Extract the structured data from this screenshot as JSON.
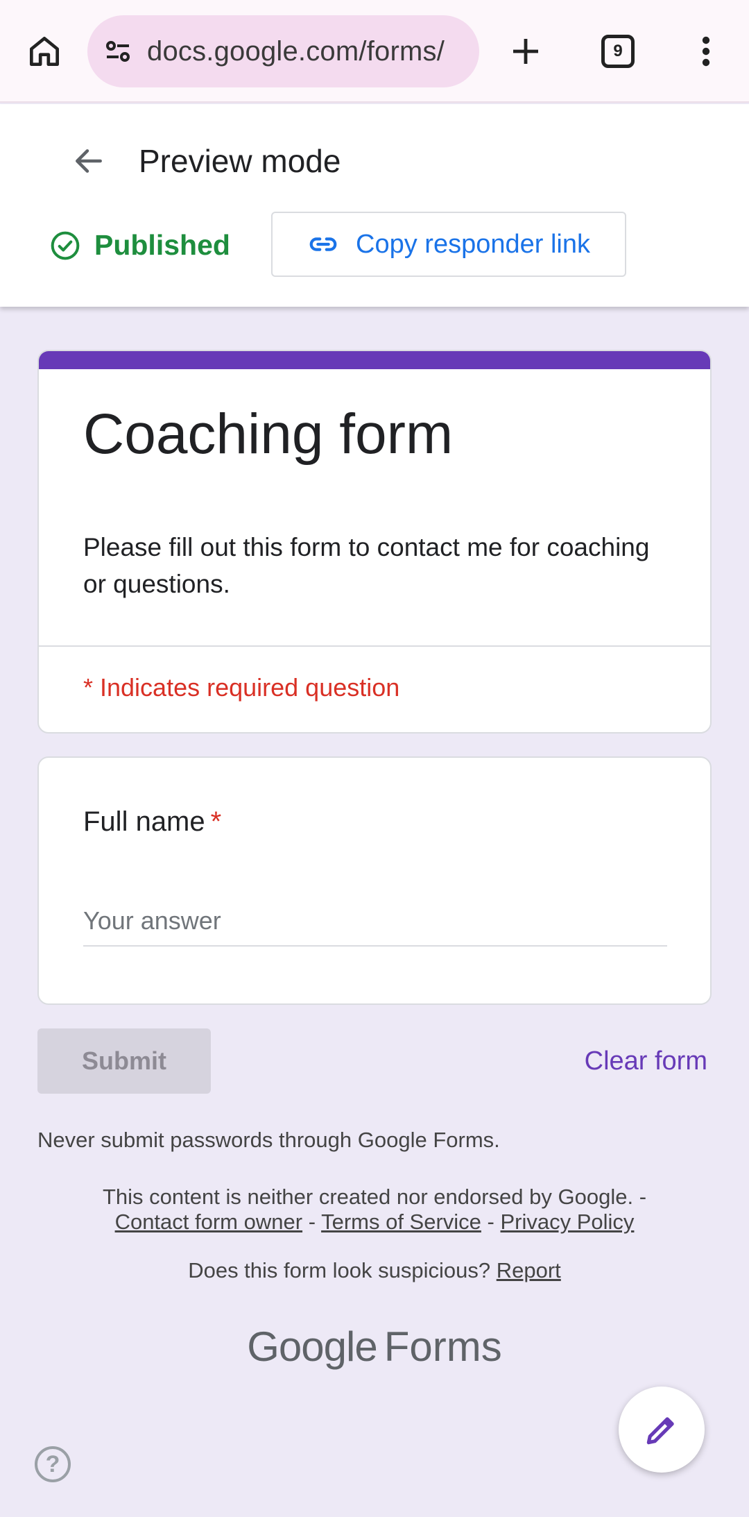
{
  "browser": {
    "url": "docs.google.com/forms/",
    "tab_count": "9",
    "icons": [
      "home-icon",
      "site-settings-icon",
      "new-tab-icon",
      "tab-switcher-icon",
      "overflow-menu-icon"
    ]
  },
  "header": {
    "title": "Preview mode",
    "status": "Published",
    "copy_link_label": "Copy responder link"
  },
  "form": {
    "title": "Coaching form",
    "description": "Please fill out this form to contact me for coaching or questions.",
    "required_note": "* Indicates required question",
    "questions": [
      {
        "label": "Full name",
        "required_mark": "*",
        "placeholder": "Your answer",
        "value": ""
      }
    ],
    "submit_label": "Submit",
    "clear_label": "Clear form"
  },
  "footer": {
    "password_warning": "Never submit passwords through Google Forms.",
    "disclaimer": "This content is neither created nor endorsed by Google. -",
    "links": [
      "Contact form owner",
      "Terms of Service",
      "Privacy Policy"
    ],
    "separator": "-",
    "suspicious_text": "Does this form look suspicious?",
    "report_link": "Report",
    "logo_google": "Google",
    "logo_forms": "Forms"
  },
  "colors": {
    "accent": "#673ab7",
    "published": "#1e8e3e",
    "link": "#1a73e8",
    "required": "#d93025",
    "background": "#ede9f6"
  }
}
